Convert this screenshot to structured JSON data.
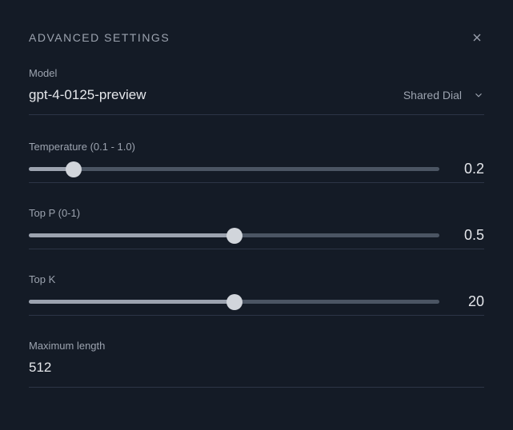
{
  "title": "ADVANCED SETTINGS",
  "model": {
    "label": "Model",
    "value": "gpt-4-0125-preview",
    "shared_label": "Shared Dial"
  },
  "temperature": {
    "label": "Temperature (0.1 - 1.0)",
    "value": "0.2",
    "min": 0.1,
    "max": 1.0,
    "current": 0.2
  },
  "top_p": {
    "label": "Top P (0-1)",
    "value": "0.5",
    "min": 0,
    "max": 1,
    "current": 0.5
  },
  "top_k": {
    "label": "Top K",
    "value": "20",
    "min": 0,
    "max": 40,
    "current": 20
  },
  "max_length": {
    "label": "Maximum length",
    "value": "512"
  }
}
